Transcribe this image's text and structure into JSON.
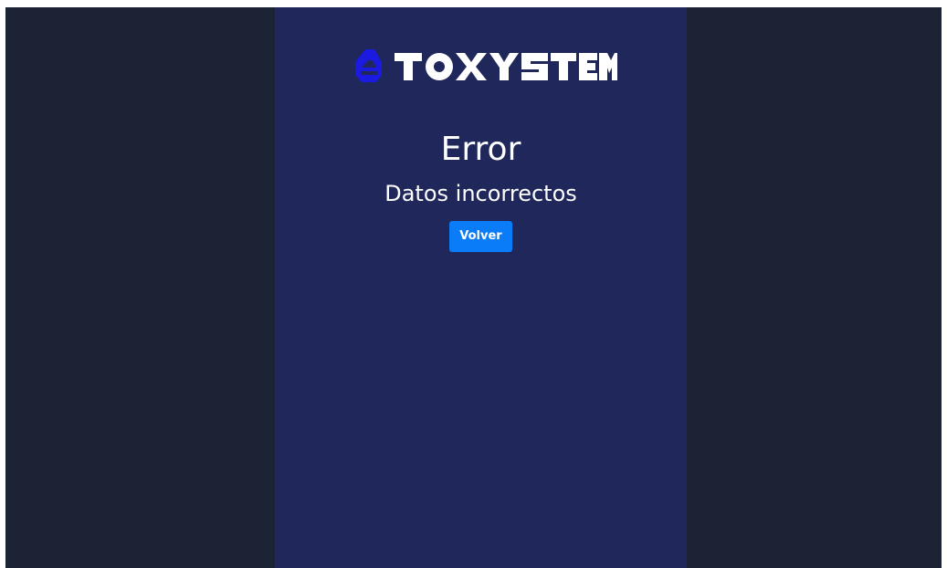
{
  "brand": {
    "logo_icon": "toxystem-logo-icon",
    "logo_text": "TOXYSTEM",
    "icon_color": "#1a1ae0",
    "text_color": "#ffffff"
  },
  "error": {
    "title": "Error",
    "message": "Datos incorrectos"
  },
  "actions": {
    "back_label": "Volver"
  },
  "colors": {
    "background": "#1b2334",
    "panel": "#20275a",
    "button": "#0b7cf7"
  }
}
